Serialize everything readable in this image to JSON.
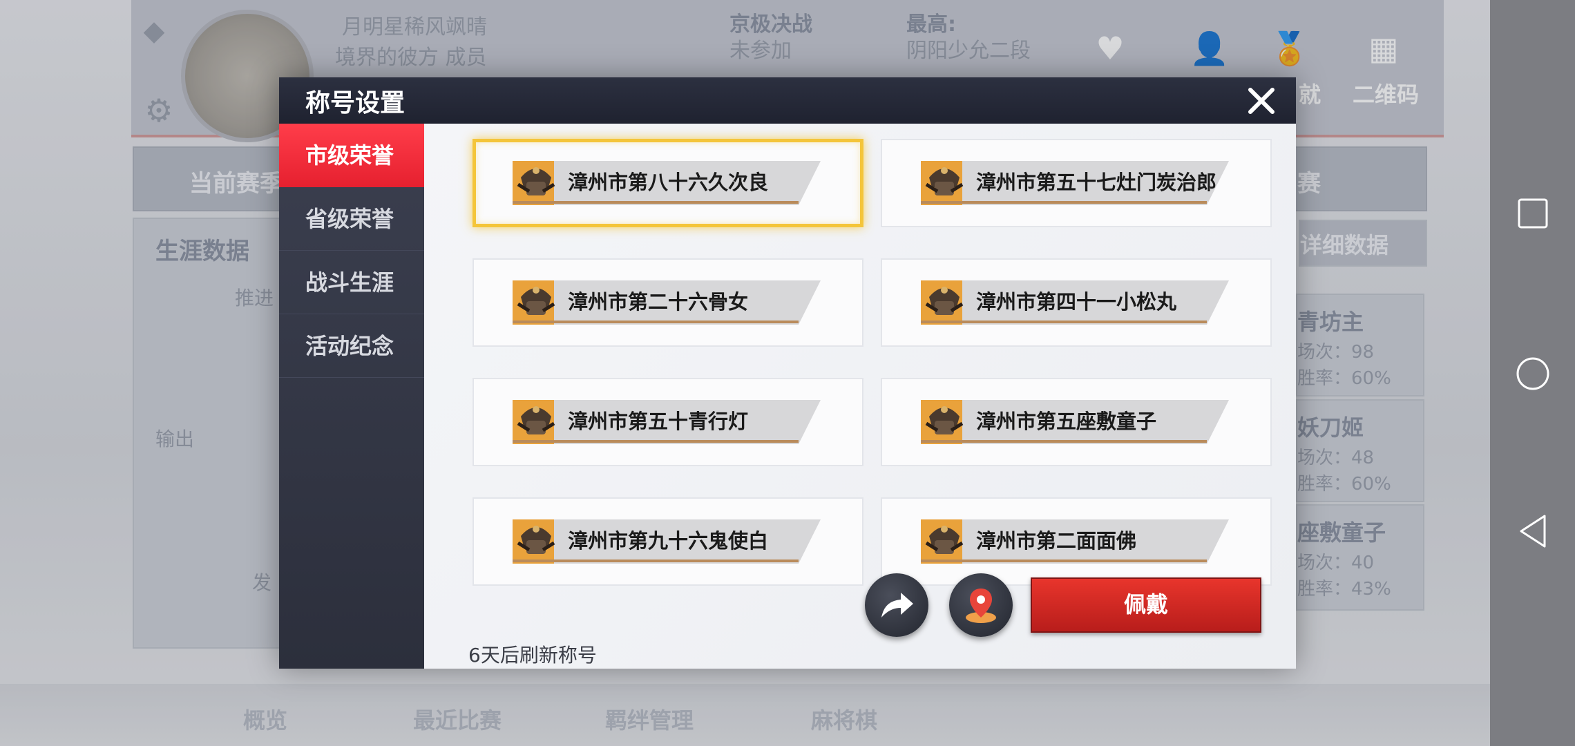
{
  "background": {
    "player_line1": "月明星稀风飒晴",
    "player_line2": "境界的彼方 成员",
    "rank_title": "京极决战",
    "rank_status": "未参加",
    "best_label": "最高:",
    "best_value": "阴阳少允二段",
    "qrcode_label": "二维码",
    "achieve_fragment": "就",
    "tab_current_season": "当前赛季",
    "tab_fragment": "赛",
    "career_header": "生涯数据",
    "detail_button": "详细数据",
    "stat_output": "输出",
    "stat_promote": "推进",
    "stat_fa": "发",
    "heroes": [
      {
        "name": "青坊主",
        "matches": "场次：98",
        "winrate": "胜率：60%"
      },
      {
        "name": "妖刀姬",
        "matches": "场次：48",
        "winrate": "胜率：60%"
      },
      {
        "name": "座敷童子",
        "matches": "场次：40",
        "winrate": "胜率：43%"
      }
    ],
    "bottom_tabs": [
      "概览",
      "最近比赛",
      "羁绊管理",
      "麻将棋"
    ]
  },
  "dialog": {
    "title": "称号设置",
    "tabs": [
      {
        "label": "市级荣誉",
        "active": true
      },
      {
        "label": "省级荣誉",
        "active": false
      },
      {
        "label": "战斗生涯",
        "active": false
      },
      {
        "label": "活动纪念",
        "active": false
      }
    ],
    "titles": [
      {
        "text": "漳州市第八十六久次良",
        "selected": true
      },
      {
        "text": "漳州市第五十七灶门炭治郎",
        "selected": false
      },
      {
        "text": "漳州市第二十六骨女",
        "selected": false
      },
      {
        "text": "漳州市第四十一小松丸",
        "selected": false
      },
      {
        "text": "漳州市第五十青行灯",
        "selected": false
      },
      {
        "text": "漳州市第五座敷童子",
        "selected": false
      },
      {
        "text": "漳州市第九十六鬼使白",
        "selected": false
      },
      {
        "text": "漳州市第二面面佛",
        "selected": false
      }
    ],
    "refresh_note": "6天后刷新称号",
    "wear_button": "佩戴"
  },
  "colors": {
    "accent_red": "#e6202f",
    "selected_gold": "#f4c53a",
    "badge_orange": "#e9a23b",
    "dialog_header": "#1f2230"
  },
  "icons": {
    "close": "close-icon",
    "share": "share-icon",
    "location": "location-icon",
    "badge": "samurai-helmet-icon"
  }
}
